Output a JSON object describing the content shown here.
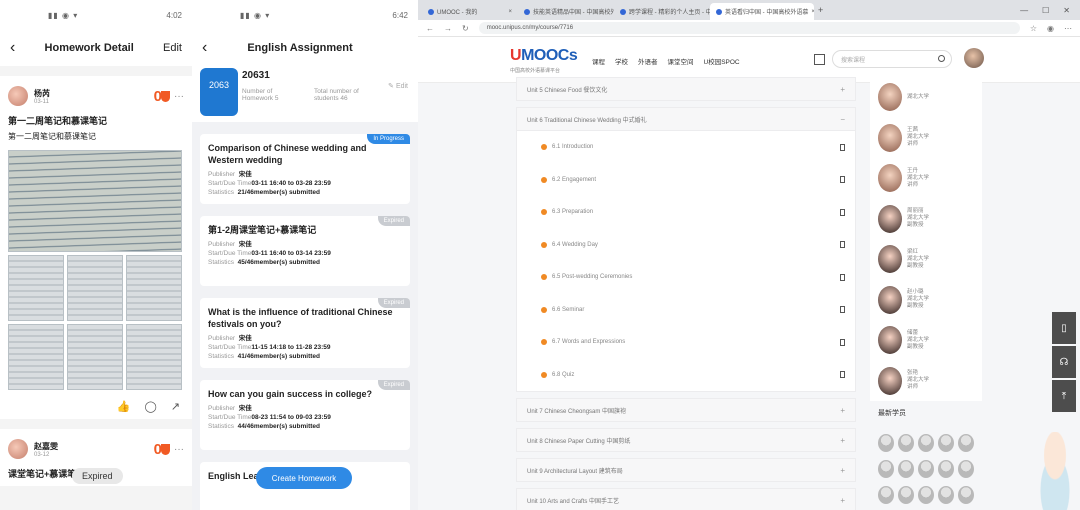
{
  "panel1": {
    "status_time": "4:02",
    "nav": {
      "title": "Homework Detail",
      "edit": "Edit"
    },
    "post1": {
      "user": "杨芮",
      "date": "03-11",
      "score": "0",
      "title": "第一二周笔记和慕课笔记",
      "body": "第一二周笔记和慕课笔记"
    },
    "post2": {
      "user": "赵嘉雯",
      "date": "03-12",
      "score": "0",
      "title": "课堂笔记+慕课笔"
    },
    "toast": "Expired"
  },
  "panel2": {
    "status_time": "6:42",
    "nav": {
      "title": "English Assignment"
    },
    "course": {
      "badge": "2063",
      "id": "20631",
      "homework_label": "Number of Homework 5",
      "students_label": "Total number of students 46",
      "edit": "Edit"
    },
    "labels": {
      "publisher": "Publisher",
      "start_due": "Start/Due Time",
      "statistics": "Statistics"
    },
    "assignments": [
      {
        "title": "Comparison of Chinese wedding and Western wedding",
        "tag": "In Progress",
        "publisher": "宋佳",
        "time": "03-11 16:40 to 03-28 23:59",
        "stats": "21/46member(s) submitted"
      },
      {
        "title": "第1-2周课堂笔记+慕课笔记",
        "tag": "Expired",
        "publisher": "宋佳",
        "time": "03-11 16:40 to 03-14 23:59",
        "stats": "45/46member(s) submitted"
      },
      {
        "title": "What is the influence of traditional Chinese festivals on you?",
        "tag": "Expired",
        "publisher": "宋佳",
        "time": "11-15 14:18 to 11-28 23:59",
        "stats": "41/46member(s) submitted"
      },
      {
        "title": "How can you gain success in college?",
        "tag": "Expired",
        "publisher": "宋佳",
        "time": "08-23 11:54 to 09-03 23:59",
        "stats": "44/46member(s) submitted"
      },
      {
        "title": "English Learning",
        "tag": ""
      }
    ],
    "create_button": "Create Homework"
  },
  "browser": {
    "tabs": [
      "UMOOC - 我的",
      "技能英语精品中国 - 中国高校外",
      "跨学课程 - 精彩的个人主页 - 中",
      "英语看归中国 - 中国高校外语慕"
    ],
    "url": "mooc.unipus.cn/my/course/7716",
    "site": {
      "logo_u": "U",
      "logo_mooc": "MOOCs",
      "logo_sub": "中国高校外语慕课平台",
      "nav": [
        "课程",
        "学校",
        "外语者",
        "课堂空间",
        "U校园SPOC"
      ],
      "search_placeholder": "搜索课程"
    },
    "units_before": [
      {
        "label": "Unit 5 Chinese Food 餐饮文化",
        "sign": "+"
      },
      {
        "label": "Unit 6 Traditional Chinese Wedding 中式婚礼",
        "sign": "−"
      }
    ],
    "lessons": [
      "6.1 Introduction",
      "6.2 Engagement",
      "6.3 Preparation",
      "6.4 Wedding Day",
      "6.5 Post-wedding Ceremonies",
      "6.6 Seminar",
      "6.7 Words and Expressions",
      "6.8 Quiz"
    ],
    "units_after": [
      {
        "label": "Unit 7 Chinese Cheongsam 中国旗袍",
        "sign": "+"
      },
      {
        "label": "Unit 8 Chinese Paper Cutting 中国剪纸",
        "sign": "+"
      },
      {
        "label": "Unit 9 Architectural Layout 建筑布局",
        "sign": "+"
      },
      {
        "label": "Unit 10 Arts and Crafts 中国手工艺",
        "sign": "+"
      }
    ],
    "teachers": [
      {
        "name": "",
        "school": "湖北大学",
        "role": ""
      },
      {
        "name": "王茜",
        "school": "湖北大学",
        "role": "讲师"
      },
      {
        "name": "王丹",
        "school": "湖北大学",
        "role": "讲师"
      },
      {
        "name": "周丽丽",
        "school": "湖北大学",
        "role": "副教授"
      },
      {
        "name": "梁红",
        "school": "湖北大学",
        "role": "副教授"
      },
      {
        "name": "赵小璐",
        "school": "湖北大学",
        "role": "副教授"
      },
      {
        "name": "储蕾",
        "school": "湖北大学",
        "role": "副教授"
      },
      {
        "name": "张艳",
        "school": "湖北大学",
        "role": "讲师"
      }
    ],
    "learners_title": "最新学员",
    "tools": [
      "phone-icon",
      "headset-icon",
      "back-to-top-icon"
    ]
  }
}
